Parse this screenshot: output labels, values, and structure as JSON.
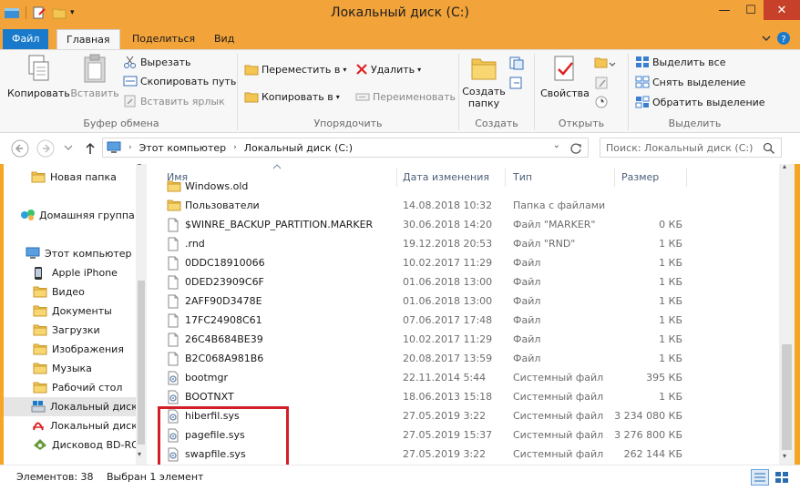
{
  "window": {
    "title": "Локальный диск (C:)",
    "minimize": "—",
    "maximize": "☐",
    "close": "✕"
  },
  "tabs": [
    {
      "label": "Файл"
    },
    {
      "label": "Главная"
    },
    {
      "label": "Поделиться"
    },
    {
      "label": "Вид"
    }
  ],
  "ribbon": {
    "clipboard": {
      "label": "Буфер обмена",
      "copy": "Копировать",
      "paste": "Вставить",
      "cut": "Вырезать",
      "copy_path": "Скопировать путь",
      "paste_shortcut": "Вставить ярлык"
    },
    "organize": {
      "label": "Упорядочить",
      "move_to": "Переместить в",
      "copy_to": "Копировать в",
      "delete": "Удалить",
      "rename": "Переименовать"
    },
    "create": {
      "label": "Создать",
      "new_folder_line1": "Создать",
      "new_folder_line2": "папку"
    },
    "open": {
      "label": "Открыть",
      "properties": "Свойства"
    },
    "select": {
      "label": "Выделить",
      "select_all": "Выделить все",
      "select_none": "Снять выделение",
      "invert": "Обратить выделение"
    }
  },
  "address": {
    "crumbs": [
      "Этот компьютер",
      "Локальный диск (C:)"
    ],
    "search_placeholder": "Поиск: Локальный диск (C:)"
  },
  "nav": [
    {
      "label": "Новая папка",
      "icon": "folder"
    },
    {
      "label": "Домашняя группа",
      "icon": "homegroup"
    },
    {
      "label": "Этот компьютер",
      "icon": "computer"
    },
    {
      "label": "Apple iPhone",
      "icon": "phone"
    },
    {
      "label": "Видео",
      "icon": "folder"
    },
    {
      "label": "Документы",
      "icon": "folder"
    },
    {
      "label": "Загрузки",
      "icon": "folder"
    },
    {
      "label": "Изображения",
      "icon": "folder"
    },
    {
      "label": "Музыка",
      "icon": "folder"
    },
    {
      "label": "Рабочий стол",
      "icon": "folder"
    },
    {
      "label": "Локальный диск",
      "icon": "drive"
    },
    {
      "label": "Локальный диск",
      "icon": "drive-pdf"
    },
    {
      "label": "Дисковод BD-RO",
      "icon": "optical"
    }
  ],
  "columns": {
    "name": "Имя",
    "date": "Дата изменения",
    "type": "Тип",
    "size": "Размер"
  },
  "files": [
    {
      "name": "Windows.old",
      "date": "",
      "type": "",
      "size": "",
      "icon": "folder"
    },
    {
      "name": "Пользователи",
      "date": "14.08.2018 10:32",
      "type": "Папка с файлами",
      "size": "",
      "icon": "folder"
    },
    {
      "name": "$WINRE_BACKUP_PARTITION.MARKER",
      "date": "30.06.2018 14:20",
      "type": "Файл \"MARKER\"",
      "size": "0 КБ",
      "icon": "file"
    },
    {
      "name": ".rnd",
      "date": "19.12.2018 20:53",
      "type": "Файл \"RND\"",
      "size": "1 КБ",
      "icon": "file"
    },
    {
      "name": "0DDC18910066",
      "date": "10.02.2017 11:29",
      "type": "Файл",
      "size": "1 КБ",
      "icon": "file"
    },
    {
      "name": "0DED23909C6F",
      "date": "01.06.2018 13:00",
      "type": "Файл",
      "size": "1 КБ",
      "icon": "file"
    },
    {
      "name": "2AFF90D3478E",
      "date": "01.06.2018 13:00",
      "type": "Файл",
      "size": "1 КБ",
      "icon": "file"
    },
    {
      "name": "17FC24908C61",
      "date": "07.06.2017 17:48",
      "type": "Файл",
      "size": "1 КБ",
      "icon": "file"
    },
    {
      "name": "26C4B684BE39",
      "date": "10.02.2017 11:29",
      "type": "Файл",
      "size": "1 КБ",
      "icon": "file"
    },
    {
      "name": "B2C068A981B6",
      "date": "20.08.2017 13:59",
      "type": "Файл",
      "size": "1 КБ",
      "icon": "file"
    },
    {
      "name": "bootmgr",
      "date": "22.11.2014 5:44",
      "type": "Системный файл",
      "size": "395 КБ",
      "icon": "sys"
    },
    {
      "name": "BOOTNXT",
      "date": "18.06.2013 15:18",
      "type": "Системный файл",
      "size": "1 КБ",
      "icon": "sys"
    },
    {
      "name": "hiberfil.sys",
      "date": "27.05.2019 3:22",
      "type": "Системный файл",
      "size": "3 234 080 КБ",
      "icon": "sys"
    },
    {
      "name": "pagefile.sys",
      "date": "27.05.2019 15:37",
      "type": "Системный файл",
      "size": "3 276 800 КБ",
      "icon": "sys"
    },
    {
      "name": "swapfile.sys",
      "date": "27.05.2019 3:22",
      "type": "Системный файл",
      "size": "262 144 КБ",
      "icon": "sys"
    }
  ],
  "status": {
    "items": "Элементов: 38",
    "selected": "Выбран 1 элемент"
  },
  "colors": {
    "accent": "#f2a33a",
    "file_tab": "#1979ca",
    "highlight": "#d21f26"
  }
}
